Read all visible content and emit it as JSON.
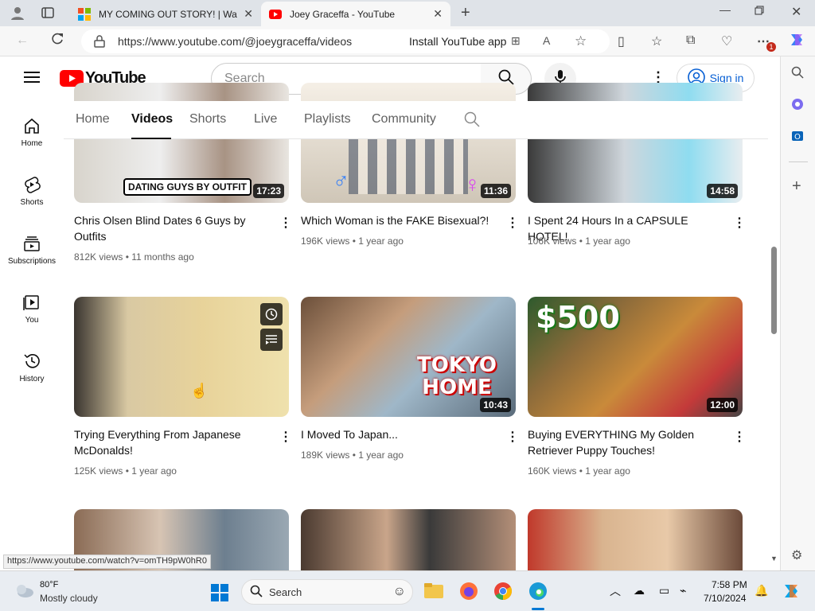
{
  "browser": {
    "tabs": [
      {
        "title": "MY COMING OUT STORY! | Watc"
      },
      {
        "title": "Joey Graceffa - YouTube"
      }
    ],
    "url": "https://www.youtube.com/@joeygraceffa/videos",
    "install_label": "Install YouTube app",
    "notification_count": "1"
  },
  "youtube": {
    "logo_text": "YouTube",
    "search_placeholder": "Search",
    "signin_label": "Sign in",
    "guide": [
      {
        "label": "Home",
        "icon": "home-icon"
      },
      {
        "label": "Shorts",
        "icon": "shorts-icon"
      },
      {
        "label": "Subscriptions",
        "icon": "subscriptions-icon"
      },
      {
        "label": "You",
        "icon": "you-icon"
      },
      {
        "label": "History",
        "icon": "history-icon"
      }
    ],
    "channel_tabs": [
      "Home",
      "Videos",
      "Shorts",
      "Live",
      "Playlists",
      "Community"
    ],
    "active_tab": "Videos"
  },
  "videos": [
    {
      "title": "Chris Olsen Blind Dates 6 Guys by Outfits",
      "views": "812K views",
      "age": "11 months ago",
      "duration": "17:23",
      "thumb_text": "DATING GUYS BY OUTFIT"
    },
    {
      "title": "Which Woman is the FAKE Bisexual?!",
      "views": "196K views",
      "age": "1 year ago",
      "duration": "11:36"
    },
    {
      "title": "I Spent 24 Hours In a CAPSULE HOTEL!",
      "views": "106K views",
      "age": "1 year ago",
      "duration": "14:58"
    },
    {
      "title": "Trying Everything From Japanese McDonalds!",
      "views": "125K views",
      "age": "1 year ago",
      "duration": ""
    },
    {
      "title": "I Moved To Japan...",
      "views": "189K views",
      "age": "1 year ago",
      "duration": "10:43",
      "thumb_text": "TOKYO HOME"
    },
    {
      "title": "Buying EVERYTHING My Golden Retriever Puppy Touches!",
      "views": "160K views",
      "age": "1 year ago",
      "duration": "12:00",
      "thumb_text": "$500"
    }
  ],
  "status_url": "https://www.youtube.com/watch?v=omTH9pW0hR0",
  "taskbar": {
    "weather_temp": "80°F",
    "weather_desc": "Mostly cloudy",
    "search_label": "Search",
    "time": "7:58 PM",
    "date": "7/10/2024"
  },
  "colors": {
    "yt_red": "#ff0000",
    "link_blue": "#065fd4",
    "tab_bar": "#dfe3e8"
  }
}
